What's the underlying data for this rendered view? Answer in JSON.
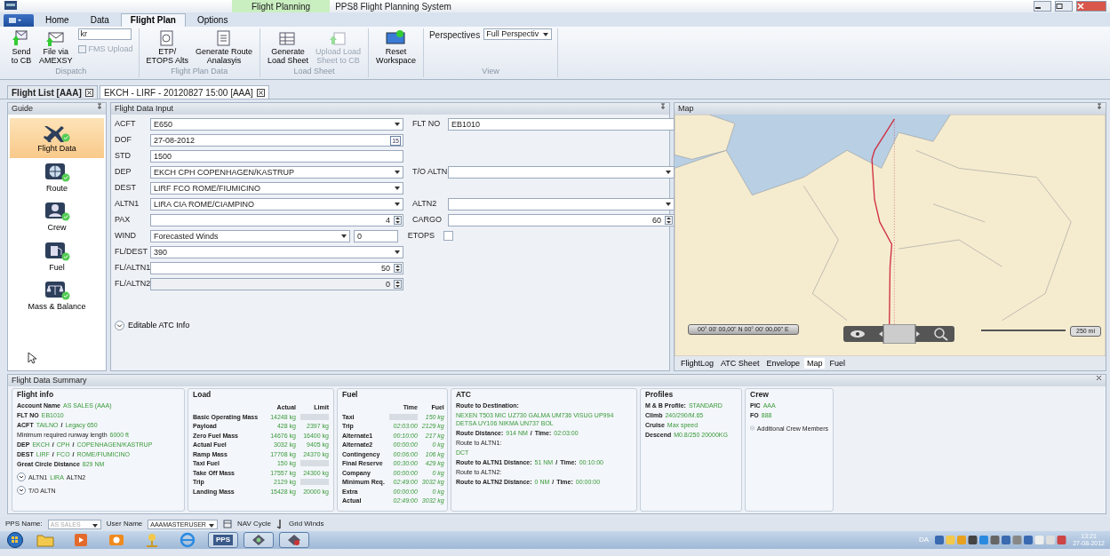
{
  "window": {
    "context_tab": "Flight Planning",
    "title": "PPS8 Flight Planning System"
  },
  "ribbon": {
    "tabs": [
      {
        "label": "Home",
        "selected": false
      },
      {
        "label": "Data",
        "selected": false
      },
      {
        "label": "Flight Plan",
        "selected": true
      },
      {
        "label": "Options",
        "selected": false
      }
    ],
    "groups": [
      {
        "label": "Dispatch",
        "items": [
          {
            "kind": "big",
            "label": "Send\nto CB",
            "disabled": false
          },
          {
            "kind": "big",
            "label": "File via\nAMEXSY",
            "disabled": false
          },
          {
            "kind": "stack",
            "field": "kr",
            "checkbox": {
              "label": "FMS Upload",
              "checked": false,
              "disabled": true
            }
          }
        ]
      },
      {
        "label": "Flight Plan Data",
        "items": [
          {
            "kind": "big",
            "label": "ETP/\nETOPS Alts",
            "disabled": false
          },
          {
            "kind": "big",
            "label": "Generate Route\nAnalasyis",
            "disabled": false
          }
        ]
      },
      {
        "label": "Load Sheet",
        "items": [
          {
            "kind": "big",
            "label": "Generate\nLoad Sheet",
            "disabled": false
          },
          {
            "kind": "big",
            "label": "Upload Load\nSheet to CB",
            "disabled": true
          }
        ]
      },
      {
        "items": [
          {
            "kind": "big",
            "label": "Reset\nWorkspace",
            "disabled": false
          }
        ]
      },
      {
        "label": "View",
        "items": [
          {
            "kind": "select",
            "label": "Perspectives",
            "value": "Full Perspectiv"
          }
        ]
      }
    ]
  },
  "doc_tabs": [
    {
      "label": "Flight List [AAA]",
      "selected": false
    },
    {
      "label": "EKCH - LIRF - 20120827 15:00 [AAA]",
      "selected": true
    }
  ],
  "guide": {
    "title": "Guide",
    "items": [
      {
        "label": "Flight Data",
        "selected": true
      },
      {
        "label": "Route",
        "selected": false
      },
      {
        "label": "Crew",
        "selected": false
      },
      {
        "label": "Fuel",
        "selected": false
      },
      {
        "label": "Mass & Balance",
        "selected": false
      }
    ]
  },
  "form": {
    "title": "Flight Data Input",
    "rows": [
      {
        "left": {
          "label": "ACFT",
          "kind": "combo",
          "value": "E650"
        },
        "right": {
          "label": "FLT NO",
          "kind": "text",
          "value": "EB1010"
        }
      },
      {
        "left": {
          "label": "DOF",
          "kind": "date",
          "value": "27-08-2012",
          "button": "15"
        }
      },
      {
        "left": {
          "label": "STD",
          "kind": "text",
          "value": "1500"
        }
      },
      {
        "left": {
          "label": "DEP",
          "kind": "combo",
          "value": "EKCH CPH COPENHAGEN/KASTRUP"
        },
        "right": {
          "label": "T/O ALTN",
          "kind": "combo"
        }
      },
      {
        "left": {
          "label": "DEST",
          "kind": "combo",
          "value": "LIRF FCO ROME/FIUMICINO"
        }
      },
      {
        "left": {
          "label": "ALTN1",
          "kind": "combo",
          "value": "LIRA CIA ROME/CIAMPINO"
        },
        "right": {
          "label": "ALTN2",
          "kind": "combo"
        }
      },
      {
        "left": {
          "label": "PAX",
          "kind": "spin",
          "value": "4"
        },
        "right": {
          "label": "CARGO",
          "kind": "spin",
          "value": "60"
        }
      },
      {
        "left": {
          "label": "WIND",
          "kind": "wind",
          "value": "Forecasted Winds",
          "extra": "0"
        },
        "right": {
          "label": "ETOPS",
          "kind": "checkbox",
          "checked": false
        }
      },
      {
        "left": {
          "label": "FL/DEST",
          "kind": "combo",
          "value": "390"
        }
      },
      {
        "left": {
          "label": "FL/ALTN1",
          "kind": "spin",
          "value": "50"
        }
      },
      {
        "left": {
          "label": "FL/ALTN2",
          "kind": "spin",
          "value": "0",
          "disabled": true
        }
      }
    ],
    "expander": {
      "label": "Editable ATC Info",
      "expanded": false
    }
  },
  "map": {
    "title": "Map",
    "coordinates": "00° 00' 00,00\" N 00° 00' 00,00\" E",
    "scale": "250 mi",
    "tabs": [
      {
        "label": "FlightLog",
        "selected": false
      },
      {
        "label": "ATC Sheet",
        "selected": false
      },
      {
        "label": "Envelope",
        "selected": false
      },
      {
        "label": "Map",
        "selected": true
      },
      {
        "label": "Fuel",
        "selected": false
      }
    ]
  },
  "summary": {
    "title": "Flight Data Summary",
    "sections": [
      {
        "kind": "lines",
        "title": "Flight info",
        "lines": [
          {
            "parts": [
              {
                "kind": "label",
                "text": "Account Name"
              },
              {
                "kind": "value",
                "text": "AS SALES (AAA)"
              }
            ]
          },
          {
            "parts": [
              {
                "kind": "label",
                "text": "FLT NO"
              },
              {
                "kind": "value",
                "text": "EB1010"
              }
            ]
          },
          {
            "parts": [
              {
                "kind": "label",
                "text": "ACFT"
              },
              {
                "kind": "value",
                "text": "TAILNO"
              },
              {
                "kind": "sep",
                "text": "/"
              },
              {
                "kind": "value",
                "text": "Legacy 650"
              }
            ]
          },
          {
            "parts": [
              {
                "kind": "note",
                "text": "Minimum required runway length"
              },
              {
                "kind": "value",
                "text": "6000 ft"
              }
            ]
          },
          {
            "parts": [
              {
                "kind": "label",
                "text": "DEP"
              },
              {
                "kind": "value",
                "text": "EKCH"
              },
              {
                "kind": "sep",
                "text": "/"
              },
              {
                "kind": "value",
                "text": "CPH"
              },
              {
                "kind": "sep",
                "text": "/"
              },
              {
                "kind": "value",
                "text": "COPENHAGEN/KASTRUP"
              }
            ]
          },
          {
            "parts": [
              {
                "kind": "label",
                "text": "DEST"
              },
              {
                "kind": "value",
                "text": "LIRF"
              },
              {
                "kind": "sep",
                "text": "/"
              },
              {
                "kind": "value",
                "text": "FCO"
              },
              {
                "kind": "sep",
                "text": "/"
              },
              {
                "kind": "value",
                "text": "ROME/FIUMICINO"
              }
            ]
          },
          {
            "parts": [
              {
                "kind": "label",
                "text": "Great Circle Distance"
              },
              {
                "kind": "value",
                "text": "829 NM"
              }
            ]
          },
          {
            "expander": false,
            "parts": [
              {
                "kind": "note",
                "text": "ALTN1"
              },
              {
                "kind": "value",
                "text": "LIRA"
              },
              {
                "kind": "note",
                "text": "ALTN2"
              }
            ]
          },
          {
            "expander": false,
            "parts": [
              {
                "kind": "note",
                "text": "T/O ALTN"
              }
            ]
          }
        ]
      },
      {
        "kind": "table",
        "title": "Load",
        "columns": [
          "Actual",
          "Limit"
        ],
        "rows": [
          {
            "name": "Basic Operating Mass",
            "cells": [
              "14248 kg",
              null
            ]
          },
          {
            "name": "Payload",
            "cells": [
              "428 kg",
              "2397 kg"
            ]
          },
          {
            "name": "Zero Fuel Mass",
            "cells": [
              "14676 kg",
              "16400 kg"
            ]
          },
          {
            "name": "Actual Fuel",
            "cells": [
              "3032 kg",
              "9405 kg"
            ]
          },
          {
            "name": "Ramp Mass",
            "cells": [
              "17708 kg",
              "24370 kg"
            ]
          },
          {
            "name": "Taxi Fuel",
            "cells": [
              "150 kg",
              null
            ]
          },
          {
            "name": "Take Off Mass",
            "cells": [
              "17557 kg",
              "24300 kg"
            ]
          },
          {
            "name": "Trip",
            "cells": [
              "2129 kg",
              null
            ]
          },
          {
            "name": "Landing Mass",
            "cells": [
              "15428 kg",
              "20000 kg"
            ]
          }
        ]
      },
      {
        "kind": "table",
        "title": "Fuel",
        "italic": true,
        "columns": [
          "Time",
          "Fuel"
        ],
        "rows": [
          {
            "name": "Taxi",
            "cells": [
              null,
              "150 kg"
            ]
          },
          {
            "name": "Trip",
            "cells": [
              "02:03:00",
              "2129 kg"
            ]
          },
          {
            "name": "Alternate1",
            "cells": [
              "00:10:00",
              "217 kg"
            ]
          },
          {
            "name": "Alternate2",
            "cells": [
              "00:00:00",
              "0 kg"
            ]
          },
          {
            "name": "Contingency",
            "cells": [
              "00:06:00",
              "106 kg"
            ]
          },
          {
            "name": "Final Reserve",
            "cells": [
              "00:30:00",
              "429 kg"
            ]
          },
          {
            "name": "Company",
            "cells": [
              "00:00:00",
              "0 kg"
            ]
          },
          {
            "name": "Minimum Req.",
            "cells": [
              "02:49:00",
              "3032 kg"
            ]
          },
          {
            "name": "Extra",
            "cells": [
              "00:00:00",
              "0 kg"
            ]
          },
          {
            "name": "Actual",
            "cells": [
              "02:49:00",
              "3032 kg"
            ]
          }
        ]
      },
      {
        "kind": "lines",
        "title": "ATC",
        "lines": [
          {
            "parts": [
              {
                "kind": "label",
                "text": "Route to Destination:"
              }
            ]
          },
          {
            "parts": [
              {
                "kind": "value",
                "text": "NEXEN T503 MIC UZ730 GALMA UM736 VISUG UP994 DETSA UY106 NIKMA UN737 BOL"
              }
            ]
          },
          {
            "parts": [
              {
                "kind": "label",
                "text": "Route Distance:"
              },
              {
                "kind": "value",
                "text": "914 NM"
              },
              {
                "kind": "sep",
                "text": "/"
              },
              {
                "kind": "label",
                "text": "Time:"
              },
              {
                "kind": "value",
                "text": "02:03:00"
              }
            ]
          },
          {
            "parts": [
              {
                "kind": "note",
                "text": "Route to ALTN1:"
              }
            ]
          },
          {
            "parts": [
              {
                "kind": "value",
                "text": "DCT"
              }
            ]
          },
          {
            "parts": [
              {
                "kind": "label",
                "text": "Route to ALTN1 Distance:"
              },
              {
                "kind": "value",
                "text": "51 NM"
              },
              {
                "kind": "sep",
                "text": "/"
              },
              {
                "kind": "label",
                "text": "Time:"
              },
              {
                "kind": "value",
                "text": "00:10:00"
              }
            ]
          },
          {
            "parts": [
              {
                "kind": "note",
                "text": "Route to ALTN2:"
              }
            ]
          },
          {
            "parts": [
              {
                "kind": "label",
                "text": "Route to ALTN2 Distance:"
              },
              {
                "kind": "value",
                "text": "0 NM"
              },
              {
                "kind": "sep",
                "text": "/"
              },
              {
                "kind": "label",
                "text": "Time:"
              },
              {
                "kind": "value",
                "text": "00:00:00"
              }
            ]
          }
        ]
      },
      {
        "kind": "lines",
        "title": "Profiles",
        "lines": [
          {
            "parts": [
              {
                "kind": "label",
                "text": "M & B Profile:"
              },
              {
                "kind": "value",
                "text": "STANDARD"
              }
            ]
          },
          {
            "parts": [
              {
                "kind": "label",
                "text": "Climb"
              },
              {
                "kind": "value",
                "text": "240/290/M.65"
              }
            ]
          },
          {
            "parts": [
              {
                "kind": "label",
                "text": "Cruise"
              },
              {
                "kind": "value",
                "text": "Max speed"
              }
            ]
          },
          {
            "parts": [
              {
                "kind": "label",
                "text": "Descend"
              },
              {
                "kind": "value",
                "text": "M0.8/250 20000KG"
              }
            ]
          }
        ]
      },
      {
        "kind": "lines",
        "title": "Crew",
        "lines": [
          {
            "parts": [
              {
                "kind": "label",
                "text": "PIC"
              },
              {
                "kind": "value",
                "text": "AAA"
              }
            ]
          },
          {
            "parts": [
              {
                "kind": "label",
                "text": "FO"
              },
              {
                "kind": "value",
                "text": "888"
              }
            ]
          },
          {
            "expander": false,
            "parts": [
              {
                "kind": "note",
                "text": "Additional Crew Members"
              }
            ]
          }
        ]
      }
    ]
  },
  "status_bar": {
    "pps_name": {
      "label": "PPS Name:",
      "value": "AS SALES",
      "disabled": true
    },
    "user_name": {
      "label": "User Name",
      "value": "AAAMASTERUSER"
    },
    "nav_cycle": "NAV Cycle",
    "grid_winds": "Grid Winds"
  },
  "taskbar": {
    "apps": [
      {
        "kind": "folder",
        "active": false
      },
      {
        "kind": "media",
        "active": false
      },
      {
        "kind": "mail",
        "active": false
      },
      {
        "kind": "network",
        "active": false
      },
      {
        "kind": "browser",
        "active": false
      },
      {
        "kind": "pps",
        "label": "PPS",
        "active": true
      },
      {
        "kind": "app",
        "active": true
      },
      {
        "kind": "app2",
        "active": true
      }
    ],
    "language": "DA",
    "time": "13:21",
    "date": "27-08-2012"
  }
}
